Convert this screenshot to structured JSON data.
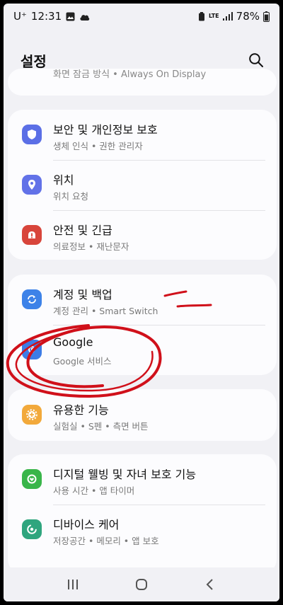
{
  "status_bar": {
    "carrier": "U⁺",
    "time": "12:31",
    "network": "LTE",
    "battery": "78%"
  },
  "header": {
    "title": "설정"
  },
  "partial_item": {
    "subtitle": "화면 잠금 방식 • Always On Display"
  },
  "groups": [
    {
      "items": [
        {
          "title": "보안 및 개인정보 보호",
          "subtitle": "생체 인식 • 권한 관리자",
          "icon": "shield-icon",
          "color": "#5b6fe6"
        },
        {
          "title": "위치",
          "subtitle": "위치 요청",
          "icon": "location-pin-icon",
          "color": "#6272e8"
        },
        {
          "title": "안전 및 긴급",
          "subtitle": "의료정보 • 재난문자",
          "icon": "emergency-icon",
          "color": "#d8453b"
        }
      ]
    },
    {
      "items": [
        {
          "title": "계정 및 백업",
          "subtitle": "계정 관리 • Smart Switch",
          "icon": "sync-icon",
          "color": "#3d82e8"
        },
        {
          "title": "Google",
          "subtitle": "Google 서비스",
          "icon": "google-icon",
          "color": "#3d7ce6"
        }
      ]
    },
    {
      "items": [
        {
          "title": "유용한 기능",
          "subtitle": "실험실 • S펜 • 측면 버튼",
          "icon": "plus-gear-icon",
          "color": "#f2a93b"
        }
      ]
    },
    {
      "items": [
        {
          "title": "디지털 웰빙 및 자녀 보호 기능",
          "subtitle": "사용 시간 • 앱 타이머",
          "icon": "wellbeing-icon",
          "color": "#39b54a"
        },
        {
          "title": "디바이스 케어",
          "subtitle": "저장공간 • 메모리 • 앱 보호",
          "icon": "device-care-icon",
          "color": "#2fa57e"
        }
      ]
    }
  ]
}
